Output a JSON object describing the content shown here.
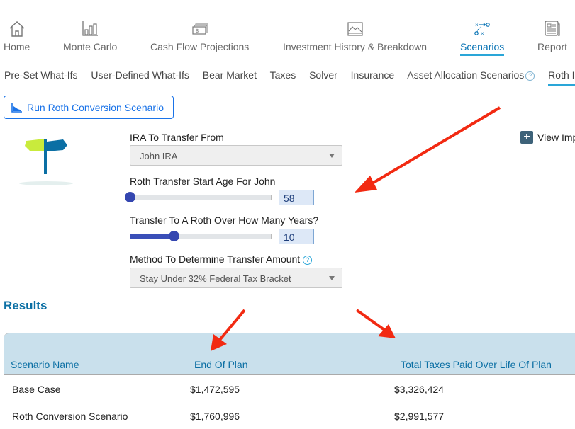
{
  "top_nav": {
    "items": [
      {
        "label": "Home",
        "icon": "home-icon"
      },
      {
        "label": "Monte Carlo",
        "icon": "bar-chart-icon"
      },
      {
        "label": "Cash Flow Projections",
        "icon": "cash-icon"
      },
      {
        "label": "Investment History & Breakdown",
        "icon": "image-chart-icon"
      },
      {
        "label": "Scenarios",
        "icon": "play-diagram-icon",
        "active": true
      },
      {
        "label": "Report",
        "icon": "report-icon"
      }
    ]
  },
  "sub_nav": {
    "items": [
      {
        "label": "Pre-Set What-Ifs"
      },
      {
        "label": "User-Defined What-Ifs"
      },
      {
        "label": "Bear Market"
      },
      {
        "label": "Taxes"
      },
      {
        "label": "Solver"
      },
      {
        "label": "Insurance"
      },
      {
        "label": "Asset Allocation Scenarios",
        "help": "?"
      },
      {
        "label": "Roth IRA C",
        "active": true
      }
    ]
  },
  "run_button": {
    "label": "Run Roth Conversion Scenario"
  },
  "form": {
    "ira_from": {
      "label": "IRA To Transfer From",
      "value": "John IRA"
    },
    "start_age": {
      "label": "Roth Transfer Start Age For John",
      "value": "58",
      "slider_fraction": 0.0
    },
    "years": {
      "label": "Transfer To A Roth Over How Many Years?",
      "value": "10",
      "slider_fraction": 0.31
    },
    "method": {
      "label": "Method To Determine Transfer Amount",
      "help": "?",
      "value": "Stay Under 32% Federal Tax Bracket"
    }
  },
  "view_imp": {
    "label": "View Imp",
    "icon": "+"
  },
  "results": {
    "title": "Results",
    "columns": [
      "Scenario Name",
      "End Of Plan",
      "Total Taxes Paid Over Life Of Plan"
    ],
    "rows": [
      {
        "name": "Base Case",
        "end_of_plan": "$1,472,595",
        "total_taxes": "$3,326,424"
      },
      {
        "name": "Roth Conversion Scenario",
        "end_of_plan": "$1,760,996",
        "total_taxes": "$2,991,577"
      }
    ]
  },
  "colors": {
    "accent": "#0a74b5",
    "active_underline": "#2aa6d8",
    "button_blue": "#1a73e8",
    "table_header_bg": "#c9e0ec",
    "annotation_red": "#f22a12"
  }
}
